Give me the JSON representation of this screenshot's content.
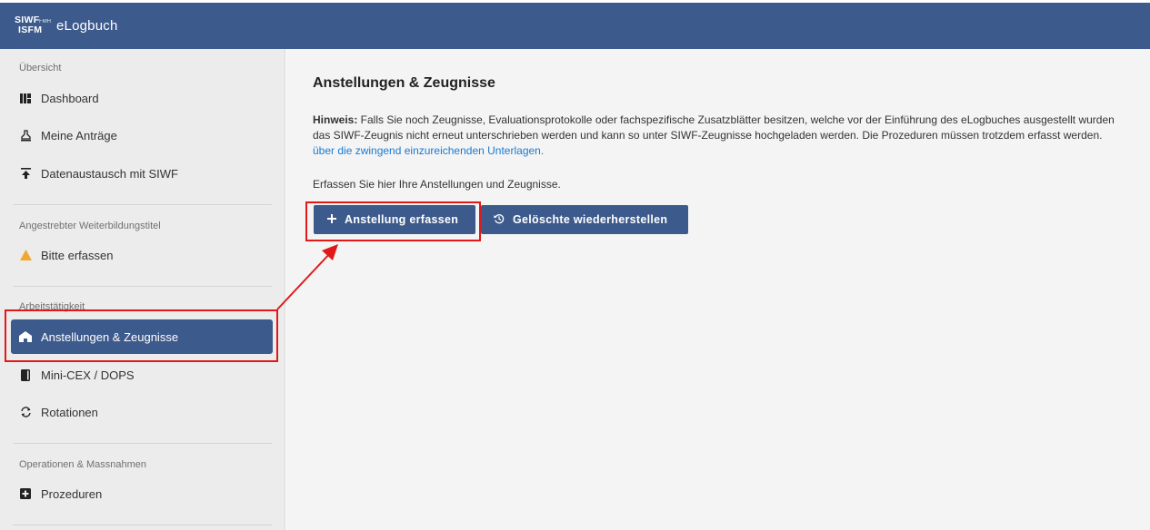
{
  "app": {
    "logo_line1": "SIWF",
    "logo_line2": "ISFM",
    "logo_sup": "FMH",
    "title": "eLogbuch"
  },
  "sidebar": {
    "sections": [
      {
        "title": "Übersicht",
        "items": [
          {
            "label": "Dashboard",
            "icon": "dashboard-icon"
          },
          {
            "label": "Meine Anträge",
            "icon": "stamp-icon"
          },
          {
            "label": "Datenaustausch mit SIWF",
            "icon": "upload-icon"
          }
        ]
      },
      {
        "title": "Angestrebter Weiterbildungstitel",
        "items": [
          {
            "label": "Bitte erfassen",
            "icon": "warning-icon"
          }
        ]
      },
      {
        "title": "Arbeitstätigkeit",
        "items": [
          {
            "label": "Anstellungen & Zeugnisse",
            "icon": "building-icon",
            "active": true
          },
          {
            "label": "Mini-CEX / DOPS",
            "icon": "book-icon"
          },
          {
            "label": "Rotationen",
            "icon": "rotate-icon"
          }
        ]
      },
      {
        "title": "Operationen & Massnahmen",
        "items": [
          {
            "label": "Prozeduren",
            "icon": "plus-square-icon"
          }
        ]
      }
    ]
  },
  "main": {
    "title": "Anstellungen & Zeugnisse",
    "hint_label": "Hinweis:",
    "hint_line1": " Falls Sie noch Zeugnisse, Evaluationsprotokolle oder fachspezifische Zusatzblätter besitzen, welche vor der Einführung des eLogbuches ausgestellt wurden",
    "hint_line2": "das SIWF-Zeugnis nicht erneut unterschrieben werden und kann so unter SIWF-Zeugnisse hochgeladen werden. Die Prozeduren müssen trotzdem erfasst werden.",
    "hint_link": "über die zwingend einzureichenden Unterlagen.",
    "lead": "Erfassen Sie hier Ihre Anstellungen und Zeugnisse.",
    "buttons": {
      "add_label": "Anstellung erfassen",
      "add_icon": "plus-icon",
      "restore_label": "Gelöschte wiederherstellen",
      "restore_icon": "history-icon"
    }
  },
  "colors": {
    "brand": "#3d5a8c",
    "link": "#1a7bd1",
    "highlight": "#e01818",
    "warning": "#f0a830"
  }
}
